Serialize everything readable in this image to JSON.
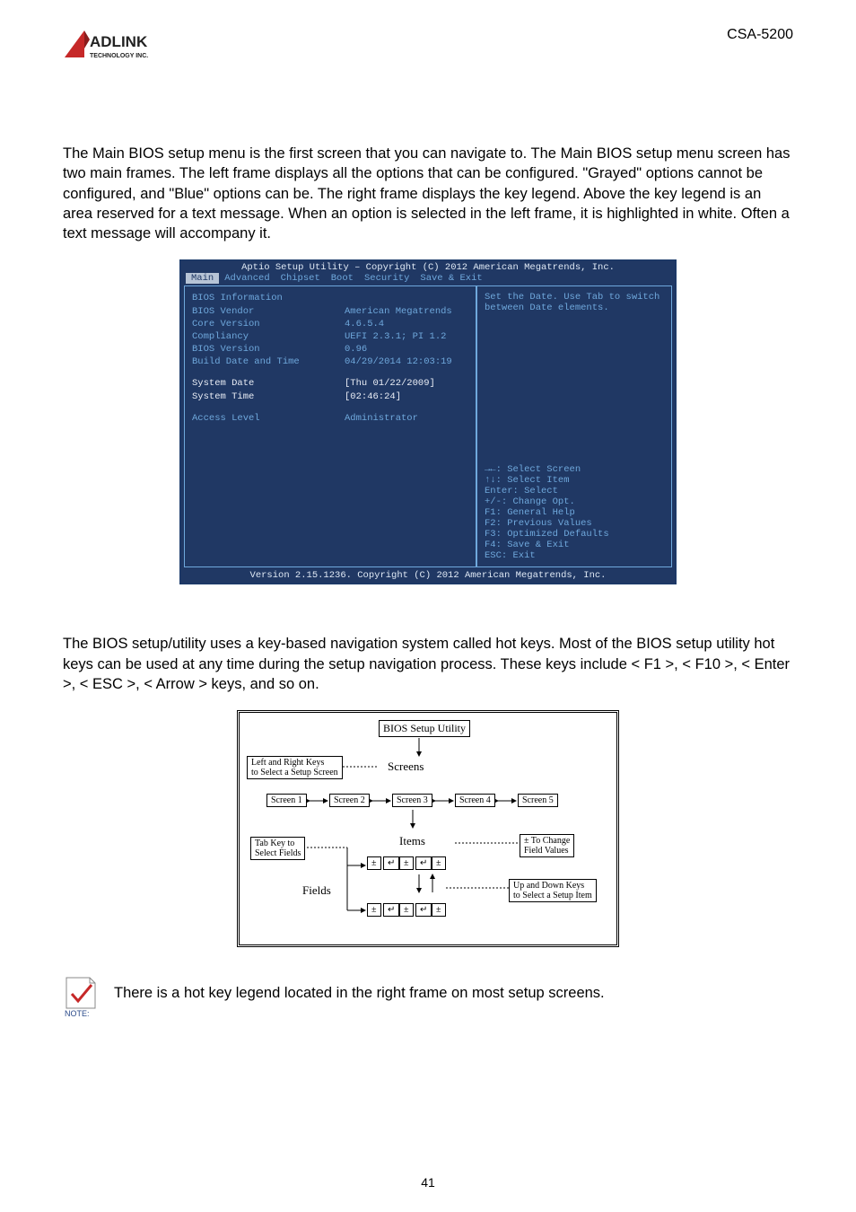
{
  "header": {
    "logo_main": "ADLINK",
    "logo_sub": "TECHNOLOGY INC.",
    "product": "CSA-5200"
  },
  "para1": "The Main BIOS setup menu is the first screen that you can navigate to. The Main BIOS setup menu screen has two main frames. The left frame displays all the options that can be configured. \"Grayed\" options cannot be configured, and \"Blue\" options can be. The right frame displays the key legend. Above the key legend is an area reserved for a text message. When an option is selected in the left frame, it is highlighted in white. Often a text message will accompany it.",
  "bios": {
    "title": "Aptio Setup Utility – Copyright (C) 2012 American Megatrends, Inc.",
    "tabs": [
      "Main",
      "Advanced",
      "Chipset",
      "Boot",
      "Security",
      "Save & Exit"
    ],
    "left": {
      "heading": "BIOS Information",
      "rows": [
        {
          "label": "BIOS Vendor",
          "value": "American Megatrends"
        },
        {
          "label": "Core Version",
          "value": "4.6.5.4"
        },
        {
          "label": "Compliancy",
          "value": "UEFI 2.3.1; PI 1.2"
        },
        {
          "label": "BIOS Version",
          "value": "0.96"
        },
        {
          "label": "Build Date and Time",
          "value": "04/29/2014 12:03:19"
        }
      ],
      "sys_date_label": "System Date",
      "sys_date_value": "[Thu 01/22/2009]",
      "sys_time_label": "System Time",
      "sys_time_value": "[02:46:24]",
      "access_label": "Access Level",
      "access_value": "Administrator"
    },
    "right_help": "Set the Date. Use Tab to switch between Date elements.",
    "legend": [
      "→←: Select Screen",
      "↑↓: Select Item",
      "Enter: Select",
      "+/-: Change Opt.",
      "F1: General Help",
      "F2: Previous Values",
      "F3: Optimized Defaults",
      "F4: Save & Exit",
      "ESC: Exit"
    ],
    "footer": "Version 2.15.1236. Copyright (C) 2012 American Megatrends, Inc."
  },
  "para2": "The BIOS setup/utility uses a key-based navigation system called hot keys. Most of the BIOS setup utility hot keys can be used at any time during the setup navigation process. These keys include < F1 >, < F10 >, < Enter >, < ESC >, < Arrow > keys, and so on.",
  "diagram": {
    "top_box": "BIOS Setup Utility",
    "lr_keys": "Left and Right Keys\nto Select a Setup Screen",
    "screens_label": "Screens",
    "screens": [
      "Screen 1",
      "Screen 2",
      "Screen 3",
      "Screen 4",
      "Screen 5"
    ],
    "tab_key": "Tab Key to\nSelect Fields",
    "items_label": "Items",
    "fields_label": "Fields",
    "change": "± To Change\nField Values",
    "updown": "Up and Down Keys\nto Select a Setup Item",
    "pm": "±",
    "enter": "↵"
  },
  "note_text": "There is a hot key legend located in the right frame on most setup screens.",
  "note_label": "NOTE:",
  "page_number": "41"
}
